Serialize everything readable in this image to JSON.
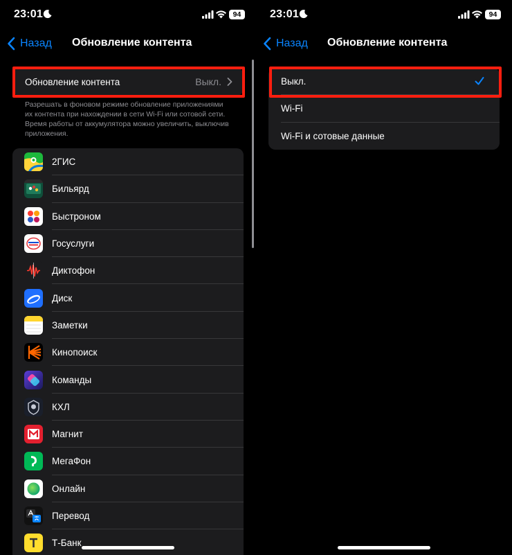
{
  "status_bar": {
    "time": "23:01",
    "battery": "94"
  },
  "left": {
    "nav": {
      "back_label": "Назад",
      "title": "Обновление контента"
    },
    "setting_row": {
      "label": "Обновление контента",
      "value": "Выкл."
    },
    "footnote": "Разрешать в фоновом режиме обновление приложениями их контента при нахождении в сети Wi-Fi или сотовой сети. Время работы от аккумулятора можно увеличить, выключив приложения.",
    "apps": [
      {
        "name": "2ГИС",
        "icon": "2gis-icon"
      },
      {
        "name": "Бильярд",
        "icon": "billiards-icon"
      },
      {
        "name": "Быстроном",
        "icon": "bystronom-icon"
      },
      {
        "name": "Госуслуги",
        "icon": "gosuslugi-icon"
      },
      {
        "name": "Диктофон",
        "icon": "voice-memos-icon"
      },
      {
        "name": "Диск",
        "icon": "disk-icon"
      },
      {
        "name": "Заметки",
        "icon": "notes-icon"
      },
      {
        "name": "Кинопоиск",
        "icon": "kinopoisk-icon"
      },
      {
        "name": "Команды",
        "icon": "shortcuts-icon"
      },
      {
        "name": "КХЛ",
        "icon": "khl-icon"
      },
      {
        "name": "Магнит",
        "icon": "magnit-icon"
      },
      {
        "name": "МегаФон",
        "icon": "megafon-icon"
      },
      {
        "name": "Онлайн",
        "icon": "online-icon"
      },
      {
        "name": "Перевод",
        "icon": "translate-icon"
      },
      {
        "name": "Т-Банк",
        "icon": "tbank-icon"
      }
    ]
  },
  "right": {
    "nav": {
      "back_label": "Назад",
      "title": "Обновление контента"
    },
    "options": [
      {
        "label": "Выкл.",
        "selected": true
      },
      {
        "label": "Wi-Fi",
        "selected": false
      },
      {
        "label": "Wi-Fi и сотовые данные",
        "selected": false
      }
    ]
  },
  "colors": {
    "accent": "#0a84ff",
    "highlight": "#ff1e0f",
    "card": "#1c1c1e",
    "background": "#000000"
  }
}
